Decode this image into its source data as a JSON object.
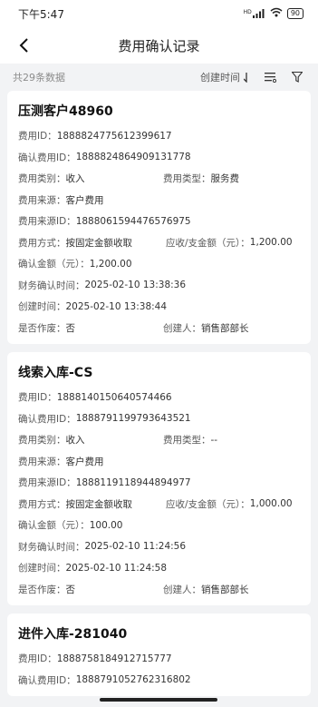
{
  "status": {
    "time": "下午5:47",
    "signal": "HD",
    "battery": "90"
  },
  "nav": {
    "title": "费用确认记录"
  },
  "toolbar": {
    "count": "共29条数据",
    "sort_label": "创建时间"
  },
  "records": [
    {
      "title": "压测客户48960",
      "fee_id_label": "费用ID：",
      "fee_id": "1888824775612399617",
      "confirm_id_label": "确认费用ID：",
      "confirm_id": "1888824864909131778",
      "category_label": "费用类别：",
      "category": "收入",
      "type_label": "费用类型：",
      "type": "服务费",
      "source_label": "费用来源：",
      "source": "客户费用",
      "source_id_label": "费用来源ID：",
      "source_id": "1888061594476576975",
      "method_label": "费用方式：",
      "method": "按固定金额收取",
      "amount_label": "应收/支金额（元）：",
      "amount": "1,200.00",
      "confirm_amount_label": "确认金额（元）：",
      "confirm_amount": "1,200.00",
      "finance_time_label": "财务确认时间：",
      "finance_time": "2025-02-10 13:38:36",
      "created_label": "创建时间：",
      "created": "2025-02-10 13:38:44",
      "void_label": "是否作废：",
      "void": "否",
      "creator_label": "创建人：",
      "creator": "销售部部长"
    },
    {
      "title": "线索入库-CS",
      "fee_id_label": "费用ID：",
      "fee_id": "1888140150640574466",
      "confirm_id_label": "确认费用ID：",
      "confirm_id": "1888791199793643521",
      "category_label": "费用类别：",
      "category": "收入",
      "type_label": "费用类型：",
      "type": "--",
      "source_label": "费用来源：",
      "source": "客户费用",
      "source_id_label": "费用来源ID：",
      "source_id": "1888119118944894977",
      "method_label": "费用方式：",
      "method": "按固定金额收取",
      "amount_label": "应收/支金额（元）：",
      "amount": "1,000.00",
      "confirm_amount_label": "确认金额（元）：",
      "confirm_amount": "100.00",
      "finance_time_label": "财务确认时间：",
      "finance_time": "2025-02-10 11:24:56",
      "created_label": "创建时间：",
      "created": "2025-02-10 11:24:58",
      "void_label": "是否作废：",
      "void": "否",
      "creator_label": "创建人：",
      "creator": "销售部部长"
    },
    {
      "title": "进件入库-281040",
      "fee_id_label": "费用ID：",
      "fee_id": "1888758184912715777",
      "confirm_id_label": "确认费用ID：",
      "confirm_id": "1888791052762316802"
    }
  ]
}
